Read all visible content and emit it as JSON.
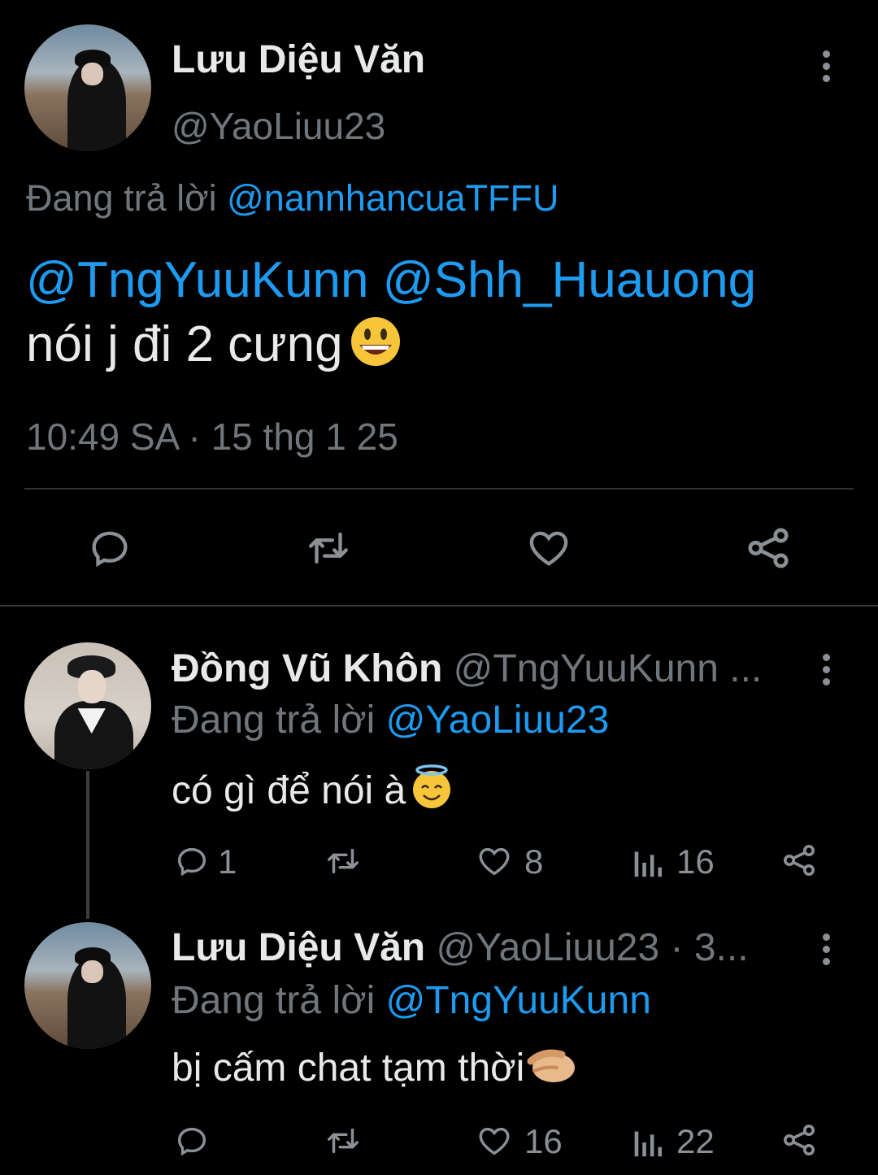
{
  "main_tweet": {
    "author_name": "Lưu Diệu Văn",
    "author_handle": "@YaoLiuu23",
    "replying_prefix": "Đang trả lời",
    "replying_to": "@nannhancuaTFFU",
    "mention_1": "@TngYuuKunn",
    "mention_2": "@Shh_Huauong",
    "text": "nói j đi 2 cưng",
    "emoji": "grinning-face",
    "timestamp": "10:49 SA · 15 thg 1 25",
    "actions": [
      "reply-icon",
      "retweet-icon",
      "like-icon",
      "share-icon"
    ]
  },
  "replies": [
    {
      "author_name": "Đồng Vũ Khôn",
      "author_handle": "@TngYuuKunn ...",
      "replying_prefix": "Đang trả lời",
      "replying_to": "@YaoLiuu23",
      "text": "có gì để nói à",
      "emoji": "smiling-face-with-halo",
      "reply_count": "1",
      "like_count": "8",
      "view_count": "16"
    },
    {
      "author_name": "Lưu Diệu Văn",
      "author_handle": "@YaoLiuu23 · 3...",
      "replying_prefix": "Đang trả lời",
      "replying_to": "@TngYuuKunn",
      "text": "bị cấm chat tạm thời",
      "emoji": "pinching-hand",
      "reply_count": "",
      "like_count": "16",
      "view_count": "22"
    }
  ],
  "colors": {
    "background": "#000000",
    "text": "#e7e9ea",
    "muted": "#71767b",
    "link": "#1d9bf0",
    "divider": "#2f3336"
  }
}
